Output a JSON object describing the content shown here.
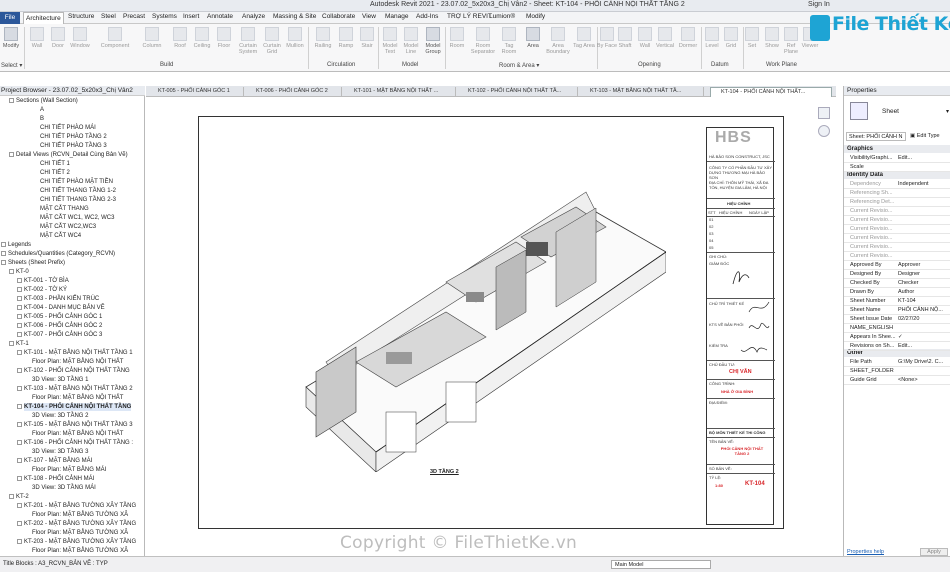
{
  "titlebar": {
    "title": "Autodesk Revit 2021 - 23.07.02_5x20x3_Chị Vân2 - Sheet: KT-104 - PHỐI CẢNH NỘI THẤT TẦNG 2",
    "signin": "Sign In"
  },
  "menu": [
    "File",
    "Architecture",
    "Structure",
    "Steel",
    "Precast",
    "Systems",
    "Insert",
    "Annotate",
    "Analyze",
    "Massing & Site",
    "Collaborate",
    "View",
    "Manage",
    "Add-Ins",
    "TRỢ LÝ REVIT",
    "Lumion®",
    "Modify"
  ],
  "ribbon": {
    "buttons": [
      "Modify",
      "Wall",
      "Door",
      "Window",
      "Component",
      "Column",
      "Roof",
      "Ceiling",
      "Floor",
      "Curtain System",
      "Curtain Grid",
      "Mullion",
      "Railing",
      "Ramp",
      "Stair",
      "Model Text",
      "Model Line",
      "Model Group",
      "Room",
      "Room Separator",
      "Tag Room",
      "Area",
      "Area Boundary",
      "Tag Area",
      "By Face",
      "Shaft",
      "Wall",
      "Vertical",
      "Dormer",
      "Level",
      "Grid",
      "Set",
      "Show",
      "Ref Plane",
      "Viewer"
    ],
    "groups": [
      "Select ▾",
      "Build",
      "Circulation",
      "Model",
      "Room & Area ▾",
      "Opening",
      "Datum",
      "Work Plane"
    ]
  },
  "browser": {
    "title": "Project Browser - 23.07.02_5x20x3_Chị Vân2",
    "items": [
      "Sections (Wall Section)",
      "A",
      "B",
      "CHI TIẾT PHÀO MÁI",
      "CHI TIẾT PHÀO TẦNG 2",
      "CHI TIẾT PHÀO TẦNG 3",
      "Detail Views (RCVN_Detail Cùng Bản Vẽ)",
      "CHI TIẾT 1",
      "CHI TIẾT 2",
      "CHI TIẾT PHÀO MẶT TIỀN",
      "CHI TIẾT THANG TẦNG 1-2",
      "CHI TIẾT THANG TẦNG 2-3",
      "MẶT CẮT THANG",
      "MẶT CẮT WC1, WC2, WC3",
      "MẶT CẮT WC2,WC3",
      "MẶT CẮT WC4",
      "Legends",
      "Schedules/Quantities (Category_RCVN)",
      "Sheets (Sheet Prefix)",
      "KT-0",
      "KT-001 - TỜ BÌA",
      "KT-002 - TỜ KÝ",
      "KT-003 - PHẦN KIẾN TRÚC",
      "KT-004 - DANH MỤC BẢN VẼ",
      "KT-005 - PHỐI CẢNH GÓC 1",
      "KT-006 - PHỐI CẢNH GÓC 2",
      "KT-007 - PHỐI CẢNH GÓC 3",
      "KT-1",
      "KT-101 - MẶT BẰNG NỘI THẤT TẦNG 1",
      "Floor Plan: MẶT BẰNG NỘI THẤT",
      "KT-102 - PHỐI CẢNH NỘI THẤT TẦNG",
      "3D View: 3D TẦNG 1",
      "KT-103 - MẶT BẰNG NỘI THẤT TẦNG 2",
      "Floor Plan: MẶT BẰNG NỘI THẤT",
      "KT-104 - PHỐI CẢNH NỘI THẤT TẦNG",
      "3D View: 3D TẦNG 2",
      "KT-105 - MẶT BẰNG NỘI THẤT TẦNG 3",
      "Floor Plan: MẶT BẰNG NỘI THẤT",
      "KT-106 - PHỐI CẢNH NỘI THẤT TẦNG :",
      "3D View: 3D TẦNG 3",
      "KT-107 - MẶT BẰNG MÁI",
      "Floor Plan: MẶT BẰNG MÁI",
      "KT-108 - PHỐI CẢNH MÁI",
      "3D View: 3D TẦNG MÁI",
      "KT-2",
      "KT-201 - MẶT BẰNG TƯỜNG XÂY TẦNG",
      "Floor Plan: MẶT BẰNG TƯỜNG XÂ",
      "KT-202 - MẶT BẰNG TƯỜNG XÂY TẦNG",
      "Floor Plan: MẶT BẰNG TƯỜNG XÂ",
      "KT-203 - MẶT BẰNG TƯỜNG XÂY TẦNG",
      "Floor Plan: MẶT BẰNG TƯỜNG XÂ"
    ]
  },
  "tabs": [
    "KT-005 - PHỐI CẢNH GÓC 1",
    "KT-006 - PHỐI CẢNH GÓC 2",
    "KT-101 - MẶT BẰNG NỘI THẤT ...",
    "KT-102 - PHỐI CẢNH NỘI THẤT TẦ...",
    "KT-103 - MẶT BẰNG NỘI THẤT TẦ...",
    "KT-104 - PHỐI CẢNH NỘI THẤT..."
  ],
  "sheet": {
    "view_label": "3D TẦNG 2",
    "company": "HBS",
    "tb_lines": [
      "HÀ BẢO SƠN CONSTRUCT, JSC",
      "CÔNG TY CỔ PHẦN ĐẦU TƯ XÂY DỰNG THƯƠNG MẠI HÀ BẢO SƠN",
      "ĐỊA CHỈ: THÔN MỸ THÁI, XÃ ĐA TỐN, HUYỆN GIA LÂM, HÀ NỘI",
      "HIỆU CHỈNH",
      "STT",
      "HIỆU CHỈNH",
      "NGÀY LẬP",
      "01",
      "02",
      "03",
      "04",
      "05",
      "GHI CHÚ:",
      "GIÁM ĐỐC",
      "CHỦ TRÌ THIẾT KẾ",
      "KTS VẼ BẢN PHỐI",
      "KIỂM TRA",
      "CHỦ ĐẦU TƯ:",
      "CHỊ VÂN",
      "CÔNG TRÌNH:",
      "NHÀ Ở GIA ĐÌNH",
      "ĐỊA ĐIỂM:",
      "BỘ MÔN THIẾT KẾ THI CÔNG",
      "TÊN BẢN VẼ:",
      "PHỐI CẢNH NỘI THẤT TẦNG 2",
      "SỐ BẢN VẼ:",
      "TỶ LỆ:",
      "1:80",
      "KT-104"
    ]
  },
  "properties": {
    "title": "Properties",
    "type": "Sheet",
    "selector": "Sheet: PHỐI CẢNH N",
    "edit_type": "Edit Type",
    "groups": {
      "graphics": "Graphics",
      "identity": "Identity Data",
      "other": "Other"
    },
    "rows": [
      {
        "k": "Visibility/Graphi...",
        "v": "Edit..."
      },
      {
        "k": "Scale",
        "v": ""
      },
      {
        "k": "Dependency",
        "v": "Independent"
      },
      {
        "k": "Referencing Sh...",
        "v": ""
      },
      {
        "k": "Referencing Det...",
        "v": ""
      },
      {
        "k": "Current Revisio...",
        "v": ""
      },
      {
        "k": "Current Revisio...",
        "v": ""
      },
      {
        "k": "Current Revisio...",
        "v": ""
      },
      {
        "k": "Current Revisio...",
        "v": ""
      },
      {
        "k": "Current Revisio...",
        "v": ""
      },
      {
        "k": "Current Revisio...",
        "v": ""
      },
      {
        "k": "Approved By",
        "v": "Approver"
      },
      {
        "k": "Designed By",
        "v": "Designer"
      },
      {
        "k": "Checked By",
        "v": "Checker"
      },
      {
        "k": "Drawn By",
        "v": "Author"
      },
      {
        "k": "Sheet Number",
        "v": "KT-104"
      },
      {
        "k": "Sheet Name",
        "v": "PHỐI CẢNH NỘ..."
      },
      {
        "k": "Sheet Issue Date",
        "v": "02/27/20"
      },
      {
        "k": "NAME_ENGLISH",
        "v": ""
      },
      {
        "k": "Appears In Shee...",
        "v": "✓"
      },
      {
        "k": "Revisions on Sh...",
        "v": "Edit..."
      },
      {
        "k": "File Path",
        "v": "G:\\My Drive\\2. C..."
      },
      {
        "k": "SHEET_FOLDER",
        "v": ""
      },
      {
        "k": "Guide Grid",
        "v": "<None>"
      }
    ],
    "help": "Properties help",
    "apply": "Apply"
  },
  "status": {
    "left": "Title Blocks : A3_RCVN_BẢN VẼ : TYP",
    "model": "Main Model"
  },
  "logo": {
    "text": "File Thiết Kế.vn"
  },
  "watermark": "Copyright © FileThietKe.vn"
}
